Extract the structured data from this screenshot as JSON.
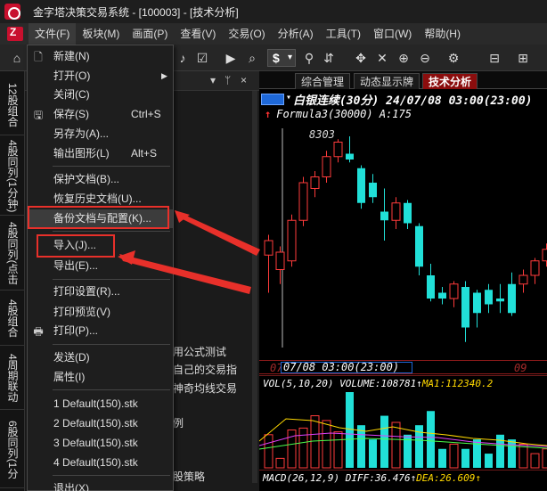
{
  "window": {
    "title": "金字塔决策交易系统 - [100003] - [技术分析]"
  },
  "menubar": {
    "items": [
      "文件(F)",
      "板块(M)",
      "画面(P)",
      "查看(V)",
      "交易(O)",
      "分析(A)",
      "工具(T)",
      "窗口(W)",
      "帮助(H)"
    ]
  },
  "toolbar": {
    "dollar_label": "$"
  },
  "left_tabs": [
    "12股组合",
    "4股同列(1分钟)",
    "4股同列(点击",
    "4股组合",
    "4周期联动",
    "6股同列(1分"
  ],
  "panel": {
    "pin_label": "ᛘ",
    "close_label": "×",
    "dropdown_arrow": "▾"
  },
  "panel_text": [
    "用公式测试",
    "自己的交易指",
    "神奇均线交易",
    "例",
    "股策略"
  ],
  "file_menu": {
    "items": [
      {
        "label": "新建(N)",
        "shortcut": "",
        "icon": "new-file-icon",
        "glyph": "🗋"
      },
      {
        "label": "打开(O)",
        "shortcut": "",
        "icon": "",
        "glyph": "",
        "submenu": true
      },
      {
        "label": "关闭(C)",
        "shortcut": "",
        "icon": "",
        "glyph": ""
      },
      {
        "label": "保存(S)",
        "shortcut": "Ctrl+S",
        "icon": "save-icon",
        "glyph": "🖫"
      },
      {
        "label": "另存为(A)...",
        "shortcut": "",
        "icon": "",
        "glyph": ""
      },
      {
        "label": "输出图形(L)",
        "shortcut": "Alt+S",
        "icon": "",
        "glyph": ""
      },
      {
        "label": "保护文档(B)...",
        "shortcut": "",
        "icon": "",
        "glyph": ""
      },
      {
        "label": "恢复历史文档(U)...",
        "shortcut": "",
        "icon": "",
        "glyph": ""
      },
      {
        "label": "备份文档与配置(K)...",
        "shortcut": "",
        "icon": "",
        "glyph": ""
      },
      {
        "label": "导入(J)...",
        "shortcut": "",
        "icon": "",
        "glyph": ""
      },
      {
        "label": "导出(E)...",
        "shortcut": "",
        "icon": "",
        "glyph": ""
      },
      {
        "label": "打印设置(R)...",
        "shortcut": "",
        "icon": "",
        "glyph": ""
      },
      {
        "label": "打印预览(V)",
        "shortcut": "",
        "icon": "",
        "glyph": ""
      },
      {
        "label": "打印(P)...",
        "shortcut": "",
        "icon": "print-icon",
        "glyph": "🖶"
      },
      {
        "label": "发送(D)",
        "shortcut": "",
        "icon": "",
        "glyph": ""
      },
      {
        "label": "属性(I)",
        "shortcut": "",
        "icon": "",
        "glyph": ""
      },
      {
        "label": "1 Default(150).stk",
        "shortcut": "",
        "icon": "",
        "glyph": ""
      },
      {
        "label": "2 Default(150).stk",
        "shortcut": "",
        "icon": "",
        "glyph": ""
      },
      {
        "label": "3 Default(150).stk",
        "shortcut": "",
        "icon": "",
        "glyph": ""
      },
      {
        "label": "4 Default(150).stk",
        "shortcut": "",
        "icon": "",
        "glyph": ""
      },
      {
        "label": "退出(X)",
        "shortcut": "",
        "icon": "",
        "glyph": ""
      }
    ]
  },
  "chart_tabs": [
    "综合管理",
    "动态显示牌",
    "技术分析"
  ],
  "chart": {
    "title": "白银连续(30分) 24/07/08 03:00(23:00)",
    "formula_line": "Formula3(30000) A:175",
    "high_label": "8303",
    "date_label": "07/08 03:00(23:00)",
    "date_left": "07",
    "date_right": "09",
    "vol_text": "VOL(5,10,20) VOLUME:108781↑",
    "vol_ma": "MA1:112340.2",
    "macd_text": "MACD(26,12,9) DIFF:36.476↑",
    "macd_dea": "DEA:26.609↑"
  },
  "chart_data": {
    "type": "candlestick",
    "candles": [
      {
        "o": 45,
        "c": 40,
        "h": 38,
        "l": 58
      },
      {
        "o": 50,
        "c": 44,
        "h": 42,
        "l": 55
      },
      {
        "o": 47,
        "c": 33,
        "h": 31,
        "l": 49
      },
      {
        "o": 33,
        "c": 20,
        "h": 18,
        "l": 35
      },
      {
        "o": 22,
        "c": 18,
        "h": 16,
        "l": 25
      },
      {
        "o": 18,
        "c": 11,
        "h": 9,
        "l": 20
      },
      {
        "o": 11,
        "c": 6,
        "h": 5,
        "l": 13
      },
      {
        "o": 10,
        "c": 12,
        "h": 4,
        "l": 13
      },
      {
        "o": 15,
        "c": 27,
        "h": 14,
        "l": 29
      },
      {
        "o": 20,
        "c": 25,
        "h": 17,
        "l": 27
      },
      {
        "o": 30,
        "c": 33,
        "h": 22,
        "l": 40
      },
      {
        "o": 33,
        "c": 27,
        "h": 25,
        "l": 36
      },
      {
        "o": 27,
        "c": 34,
        "h": 26,
        "l": 36
      },
      {
        "o": 35,
        "c": 49,
        "h": 34,
        "l": 52
      },
      {
        "o": 52,
        "c": 60,
        "h": 48,
        "l": 61
      },
      {
        "o": 58,
        "c": 60,
        "h": 56,
        "l": 62
      },
      {
        "o": 60,
        "c": 55,
        "h": 54,
        "l": 63
      },
      {
        "o": 56,
        "c": 70,
        "h": 54,
        "l": 75
      },
      {
        "o": 58,
        "c": 65,
        "h": 57,
        "l": 70
      },
      {
        "o": 57,
        "c": 62,
        "h": 55,
        "l": 65
      },
      {
        "o": 60,
        "c": 61,
        "h": 55,
        "l": 65
      },
      {
        "o": 55,
        "c": 65,
        "h": 51,
        "l": 66
      },
      {
        "o": 55,
        "c": 52,
        "h": 50,
        "l": 58
      },
      {
        "o": 52,
        "c": 47,
        "h": 46,
        "l": 55
      },
      {
        "o": 47,
        "c": 43,
        "h": 41,
        "l": 49
      }
    ],
    "volume": [
      35,
      10,
      40,
      42,
      55,
      50,
      38,
      80,
      45,
      30,
      55,
      48,
      35,
      45,
      60,
      20,
      25,
      20,
      30,
      15,
      35,
      30,
      25,
      15,
      20
    ]
  }
}
